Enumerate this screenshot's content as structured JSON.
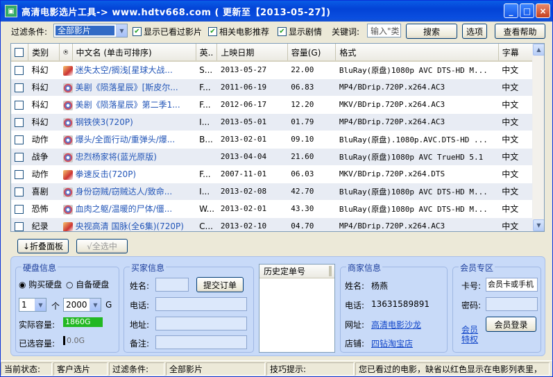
{
  "window": {
    "title": "高清电影选片工具-> www.hdtv668.com ( 更新至【2013-05-27】)",
    "minimize": "_",
    "maximize": "□",
    "close": "×"
  },
  "toolbar": {
    "filter_label": "过滤条件:",
    "filter_value": "全部影片",
    "show_watched": "显示已看过影片",
    "related": "相关电影推荐",
    "show_plot": "显示剧情",
    "keyword_label": "关键词:",
    "keyword_placeholder": "输入\"类",
    "search": "搜索",
    "options": "选项",
    "help": "查看帮助"
  },
  "table": {
    "columns": [
      "",
      "类别",
      "",
      "中文名 (单击可排序)",
      "英..",
      "上映日期",
      "容量(G)",
      "格式",
      "字幕"
    ],
    "rows": [
      {
        "category": "科幻",
        "name": "迷失太空/搁浅[星球大战...",
        "en": "S...",
        "date": "2013-05-27",
        "size": "22.00",
        "format": "BluRay(原盘)1080p AVC DTS-HD M...",
        "sub": "中文",
        "icon": "a"
      },
      {
        "category": "科幻",
        "name": "美剧《陨落星辰》[斯皮尔...",
        "en": "F...",
        "date": "2011-06-19",
        "size": "06.83",
        "format": "MP4/BDrip.720P.x264.AC3",
        "sub": "中文",
        "icon": "b"
      },
      {
        "category": "科幻",
        "name": "美剧《陨落星辰》第二季1...",
        "en": "F...",
        "date": "2012-06-17",
        "size": "12.20",
        "format": "MKV/BDrip.720P.x264.AC3",
        "sub": "中文",
        "icon": "b"
      },
      {
        "category": "科幻",
        "name": "钢铁侠3(720P)",
        "en": "I...",
        "date": "2013-05-01",
        "size": "01.79",
        "format": "MP4/BDrip.720P.x264.AC3",
        "sub": "中文",
        "icon": "b"
      },
      {
        "category": "动作",
        "name": "爆头/全面行动/重弹头/爆...",
        "en": "B...",
        "date": "2013-02-01",
        "size": "09.10",
        "format": "BluRay(原盘).1080p.AVC.DTS-HD ...",
        "sub": "中文",
        "icon": "b"
      },
      {
        "category": "战争",
        "name": "忠烈杨家将(蓝光原版)",
        "en": "",
        "date": "2013-04-04",
        "size": "21.60",
        "format": "BluRay(原盘)1080p AVC TrueHD 5.1",
        "sub": "中文",
        "icon": "b"
      },
      {
        "category": "动作",
        "name": "拳速反击(720P)",
        "en": "F...",
        "date": "2007-11-01",
        "size": "06.03",
        "format": "MKV/BDrip.720P.x264.DTS",
        "sub": "中文",
        "icon": "a"
      },
      {
        "category": "喜剧",
        "name": "身份窃贼/窃贼达人/致命...",
        "en": "I...",
        "date": "2013-02-08",
        "size": "42.70",
        "format": "BluRay(原盘)1080p AVC DTS-HD M...",
        "sub": "中文",
        "icon": "b"
      },
      {
        "category": "恐怖",
        "name": "血肉之躯/温暖的尸体/僵...",
        "en": "W...",
        "date": "2013-02-01",
        "size": "43.30",
        "format": "BluRay(原盘)1080p AVC DTS-HD M...",
        "sub": "中文",
        "icon": "b"
      },
      {
        "category": "纪录",
        "name": "央视高清 国脉(全6集)(720P)",
        "en": "C...",
        "date": "2013-02-10",
        "size": "04.70",
        "format": "MP4/BDrip.720P.x264.AC3",
        "sub": "中文",
        "icon": "a"
      }
    ]
  },
  "actions": {
    "collapse": "折叠面板",
    "select_all": "全选中"
  },
  "disk": {
    "title": "硬盘信息",
    "buy": "购买硬盘",
    "own": "自备硬盘",
    "count": "1",
    "unit_ge": "个",
    "capacity": "2000",
    "unit_g": "G",
    "actual_label": "实际容量:",
    "actual_value": "1860G",
    "selected_label": "已选容量:",
    "selected_value": "0.0G",
    "actual_fill_pct": 100,
    "selected_fill_pct": 0
  },
  "buyer": {
    "title": "买家信息",
    "name": "姓名:",
    "submit": "提交订单",
    "phone": "电话:",
    "address": "地址:",
    "note": "备注:"
  },
  "history": {
    "header": "历史定单号"
  },
  "merchant": {
    "title": "商家信息",
    "name_label": "姓名:",
    "name": "杨燕",
    "phone_label": "电话:",
    "phone": "13631589891",
    "site_label": "网址:",
    "site": "高清电影沙龙",
    "shop_label": "店铺:",
    "shop": "四钻淘宝店"
  },
  "member": {
    "title": "会员专区",
    "card_label": "卡号:",
    "card_placeholder": "会员卡或手机",
    "pwd_label": "密码:",
    "privilege_1": "会员",
    "privilege_2": "特权",
    "login": "会员登录"
  },
  "status": {
    "state_label": "当前状态:",
    "state": "客户选片",
    "filter_label": "过滤条件:",
    "filter": "全部影片",
    "tip_label": "技巧提示:",
    "tip": "您已看过的电影，缺省以红色显示在电影列表里，"
  }
}
